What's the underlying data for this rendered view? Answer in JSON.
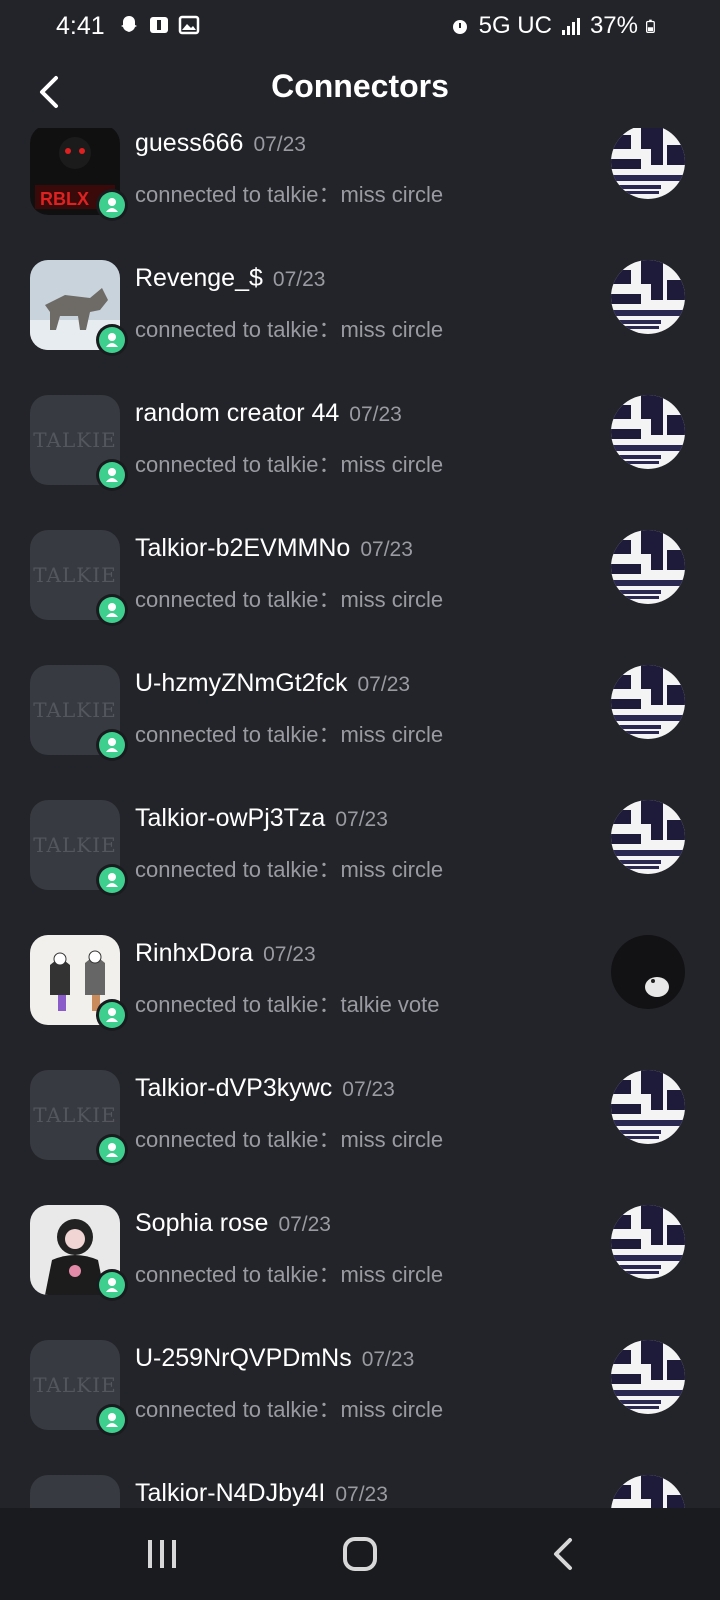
{
  "status": {
    "time": "4:41",
    "network": "5G UC",
    "battery": "37%",
    "left_icons": [
      "snapchat-icon",
      "notification-app-icon",
      "image-icon"
    ],
    "right_icons": [
      "alarm-icon",
      "signal-icon",
      "battery-icon"
    ]
  },
  "header": {
    "title": "Connectors",
    "back_icon": "chevron-left-icon"
  },
  "logo_text": "TALKIE",
  "rows": [
    {
      "name": "guess666",
      "date": "07/23",
      "sub": "connected to talkie：miss circle",
      "avatar": "photo-dark",
      "thumb": "checker"
    },
    {
      "name": "Revenge_$",
      "date": "07/23",
      "sub": "connected to talkie：miss circle",
      "avatar": "photo-wolf",
      "thumb": "checker"
    },
    {
      "name": "random creator 44",
      "date": "07/23",
      "sub": "connected to talkie：miss circle",
      "avatar": "logo",
      "thumb": "checker"
    },
    {
      "name": "Talkior-b2EVMMNo",
      "date": "07/23",
      "sub": "connected to talkie：miss circle",
      "avatar": "logo",
      "thumb": "checker"
    },
    {
      "name": "U-hzmyZNmGt2fck",
      "date": "07/23",
      "sub": "connected to talkie：miss circle",
      "avatar": "logo",
      "thumb": "checker"
    },
    {
      "name": "Talkior-owPj3Tza",
      "date": "07/23",
      "sub": "connected to talkie：miss circle",
      "avatar": "logo",
      "thumb": "checker"
    },
    {
      "name": "RinhxDora",
      "date": "07/23",
      "sub": "connected to talkie：talkie vote",
      "avatar": "photo-sketch",
      "thumb": "dark"
    },
    {
      "name": "Talkior-dVP3kywc",
      "date": "07/23",
      "sub": "connected to talkie：miss circle",
      "avatar": "logo",
      "thumb": "checker"
    },
    {
      "name": "Sophia  rose",
      "date": "07/23",
      "sub": "connected to talkie：miss circle",
      "avatar": "photo-hoodie",
      "thumb": "checker"
    },
    {
      "name": "U-259NrQVPDmNs",
      "date": "07/23",
      "sub": "connected to talkie：miss circle",
      "avatar": "logo",
      "thumb": "checker"
    },
    {
      "name": "Talkior-N4DJby4I",
      "date": "07/23",
      "sub": "",
      "avatar": "logo",
      "thumb": "checker"
    }
  ],
  "nav": [
    "recents-icon",
    "home-icon",
    "back-icon"
  ],
  "colors": {
    "background": "#232429",
    "badge": "#3ecf8e",
    "secondary_text": "#9a9ba2"
  }
}
